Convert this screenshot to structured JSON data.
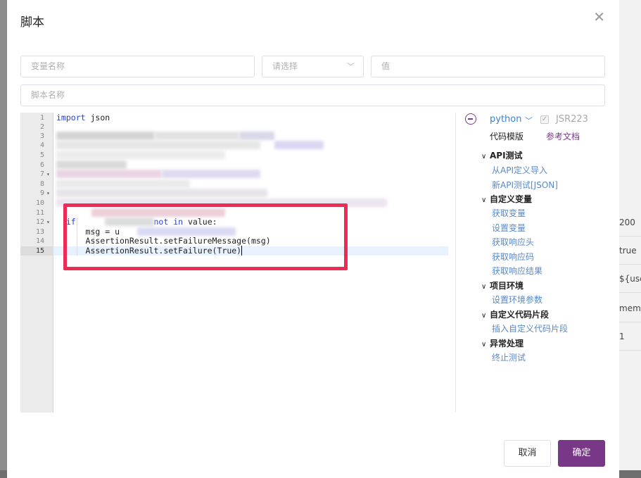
{
  "dialog": {
    "title": "脚本",
    "close_icon": "close-icon"
  },
  "form": {
    "variable_name_placeholder": "变量名称",
    "select_placeholder": "请选择",
    "value_placeholder": "值",
    "script_name_placeholder": "脚本名称"
  },
  "editor": {
    "line_numbers": [
      "1",
      "2",
      "3",
      "4",
      "5",
      "6",
      "7",
      "8",
      "9",
      "10",
      "11",
      "12",
      "13",
      "14",
      "15"
    ],
    "line1_kw": "import",
    "line1_rest": " json",
    "line12_kw_if": "if",
    "line12_not": "not",
    "line12_in": "in",
    "line12_rest": " value:",
    "line13_text": "msg = u",
    "line14_text": "AssertionResult.setFailureMessage(msg)",
    "line15_text": "AssertionResult.setFailure(True)"
  },
  "side": {
    "language": "python",
    "jsr_label": "JSR223",
    "tab_templates": "代码模版",
    "tab_docs": "参考文档",
    "groups": [
      {
        "title": "API测试",
        "items": [
          "从API定义导入",
          "新API测试[JSON]"
        ]
      },
      {
        "title": "自定义变量",
        "items": [
          "获取变量",
          "设置变量",
          "获取响应头",
          "获取响应码",
          "获取响应结果"
        ]
      },
      {
        "title": "项目环境",
        "items": [
          "设置环境参数"
        ]
      },
      {
        "title": "自定义代码片段",
        "items": [
          "插入自定义代码片段"
        ]
      },
      {
        "title": "异常处理",
        "items": [
          "终止测试"
        ]
      }
    ]
  },
  "buttons": {
    "cancel": "取消",
    "ok": "确定"
  },
  "background": {
    "values": [
      "200",
      "true",
      "${use",
      "memb",
      "1"
    ]
  },
  "colors": {
    "primary": "#783887",
    "highlight_border": "#ec2b57",
    "link": "#5a89c4"
  }
}
